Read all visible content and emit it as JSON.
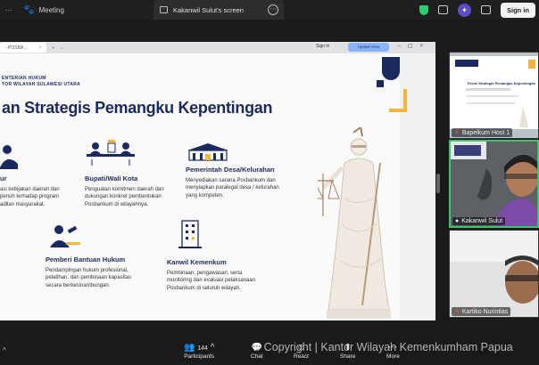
{
  "tabs": {
    "meeting_label": "Meeting",
    "share_label": "Kakanwil Sulut's screen"
  },
  "header": {
    "signin_label": "Sign in"
  },
  "browser": {
    "tab_title": "- POSBA…",
    "signin_label": "Sign in",
    "update_label": "Update Now"
  },
  "slide": {
    "org_line1": "ENTERIAN HUKUM",
    "org_line2": "TOR WILAYAH SULAWESI UTARA",
    "title": "an Strategis Pemangku Kepentingan",
    "stakeholders": [
      {
        "heading": "ur",
        "body": [
          "asi kebijakan daerah dan",
          "penuh terhadap program",
          "adilan masyarakat."
        ]
      },
      {
        "heading": "Bupati/Wali Kota",
        "body": [
          "Penguatan komitmen daerah dan",
          "dukungan konkret pembentukan",
          "Posbankum di wilayahnya."
        ]
      },
      {
        "heading": "Pemerintah Desa/Kelurahan",
        "body": [
          "Menyediakan sarana Posbankum dan",
          "menyiapkan paralegal desa / kelurahan",
          "yang kompeten."
        ]
      },
      {
        "heading": "Pemberi Bantuan Hukum",
        "body": [
          "Pendampingan hukum profesional,",
          "pelatihan, dan pembinaan kapasitas",
          "secara berkesinambungan."
        ]
      },
      {
        "heading": "Kanwil Kemenkum",
        "body": [
          "Pembinaan, pengawasan, serta",
          "monitoring dan evaluasi pelaksanaan",
          "Posbankum di seluruh wilayah."
        ]
      }
    ]
  },
  "participants": [
    {
      "name": "Bapelkum Host 1",
      "muted": true
    },
    {
      "name": "Kakanwil Sulut",
      "muted": false
    },
    {
      "name": "Kartiko Nurintias",
      "muted": true
    }
  ],
  "mini_slide": {
    "title": "Peran Strategis Pemangku Kepentingan"
  },
  "toolbar": {
    "participants_count": "144",
    "participants_label": "Participants",
    "chat_label": "Chat",
    "react_label": "React",
    "share_label": "Share",
    "more_label": "More"
  },
  "watermark": "© Copyright | Kantor Wilayah Kemenkumham Papua",
  "colors": {
    "navy": "#1b2a5e",
    "gold": "#f2b73a",
    "active_speaker": "#3ec46d",
    "muted_red": "#e05a4a"
  }
}
